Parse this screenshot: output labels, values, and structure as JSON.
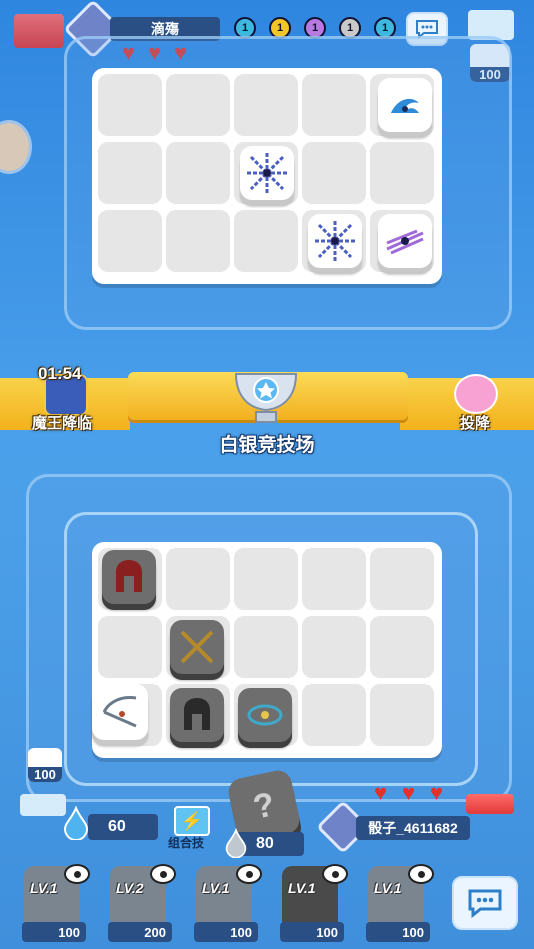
{
  "opponent": {
    "name": "滴殤",
    "coins": [
      "1",
      "1",
      "1",
      "1",
      "1"
    ],
    "coin_colors": [
      "#3fb8e0",
      "#f2c628",
      "#b77be0",
      "#c9c9c9",
      "#3fb8e0"
    ],
    "hearts": 3,
    "side_value": "100"
  },
  "banner": {
    "timer": "01:54",
    "left_label": "魔王降临",
    "right_label": "投降",
    "arena_name": "白银竞技场"
  },
  "player": {
    "name": "骰子_4611682",
    "hearts": 3,
    "sp": "60",
    "combo_label": "组合技",
    "summon_cost": "80",
    "side_value": "100"
  },
  "deck": [
    {
      "level": "LV.1",
      "cost": "100"
    },
    {
      "level": "LV.2",
      "cost": "200"
    },
    {
      "level": "LV.1",
      "cost": "100"
    },
    {
      "level": "LV.1",
      "cost": "100"
    },
    {
      "level": "LV.1",
      "cost": "100"
    }
  ],
  "icons": {
    "chat": "chat-bubble-icon",
    "eye": "eye-icon",
    "drop": "water-drop-icon",
    "trophy": "trophy-icon",
    "dice": "question-dice-icon"
  }
}
